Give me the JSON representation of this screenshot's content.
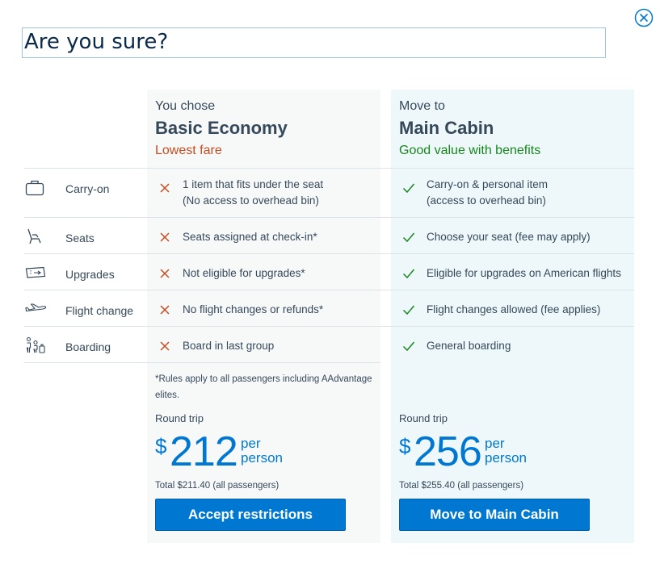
{
  "dialog": {
    "title": "Are you sure?"
  },
  "columns": {
    "left": {
      "pre": "You chose",
      "name": "Basic Economy",
      "tagline": "Lowest fare",
      "tagline_color": "#c64b1e"
    },
    "right": {
      "pre": "Move to",
      "name": "Main Cabin",
      "tagline": "Good value with benefits",
      "tagline_color": "#17871e"
    }
  },
  "rows": [
    {
      "icon": "bag-icon",
      "label": "Carry-on",
      "basic_line1": "1 item that fits under the seat",
      "basic_line2": "(No access to overhead bin)",
      "main_line1": "Carry-on & personal item",
      "main_line2": "(access to overhead bin)"
    },
    {
      "icon": "seat-icon",
      "label": "Seats",
      "basic": "Seats assigned at check-in*",
      "main": "Choose your seat (fee may apply)"
    },
    {
      "icon": "ticket-icon",
      "label": "Upgrades",
      "basic": "Not eligible for upgrades*",
      "main": "Eligible for upgrades on American flights"
    },
    {
      "icon": "plane-icon",
      "label": "Flight change",
      "basic": "No flight changes or refunds*",
      "main": "Flight changes allowed (fee applies)"
    },
    {
      "icon": "boarding-icon",
      "label": "Boarding",
      "basic": "Board in last group",
      "main": "General boarding"
    }
  ],
  "note": "*Rules apply to all passengers including AAdvantage elites.",
  "pricing": {
    "left": {
      "label": "Round trip",
      "currency": "$",
      "amount": "212",
      "per_line1": "per",
      "per_line2": "person",
      "total": "Total $211.40 (all passengers)",
      "button": "Accept restrictions"
    },
    "right": {
      "label": "Round trip",
      "currency": "$",
      "amount": "256",
      "per_line1": "per",
      "per_line2": "person",
      "total": "Total $255.40 (all passengers)",
      "button": "Move to Main Cabin"
    }
  },
  "colors": {
    "accent": "#0078d2",
    "x_mark": "#c64b1e",
    "check_mark": "#17871e"
  }
}
